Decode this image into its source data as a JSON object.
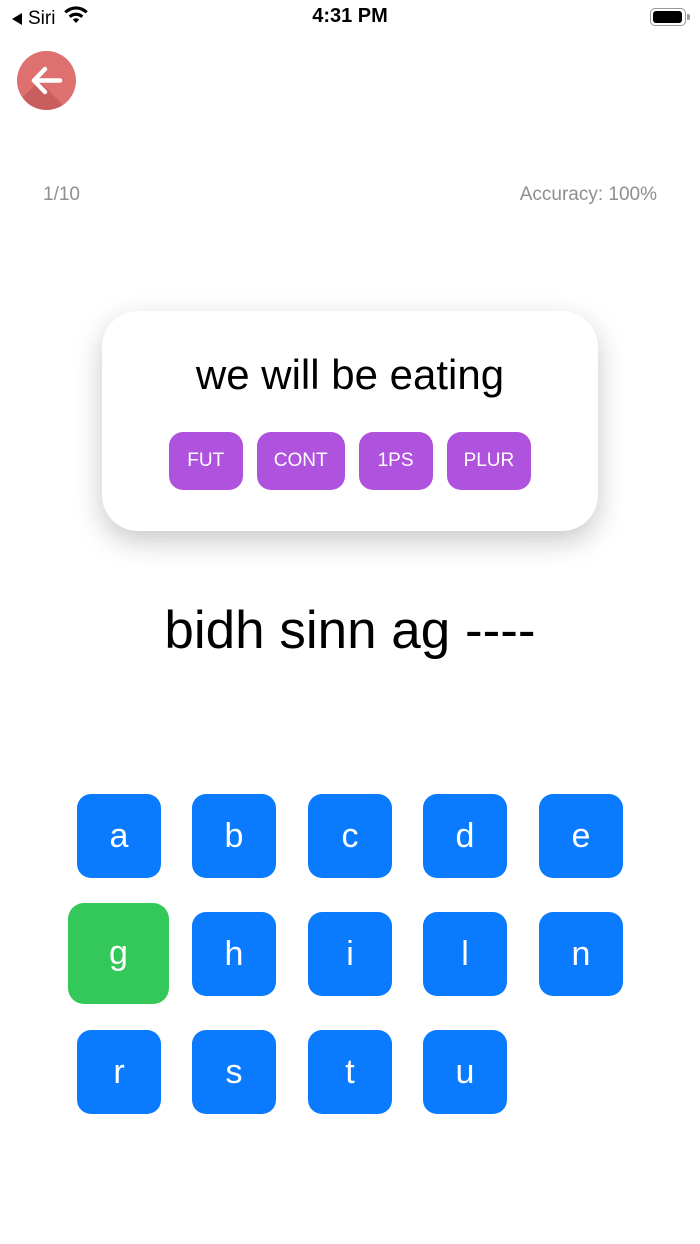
{
  "status_bar": {
    "carrier": "Siri",
    "time": "4:31 PM"
  },
  "header": {
    "back_icon": "arrow-left-icon"
  },
  "progress": {
    "counter": "1/10",
    "accuracy": "Accuracy: 100%"
  },
  "prompt": {
    "text": "we will be eating",
    "tags": [
      "FUT",
      "CONT",
      "1PS",
      "PLUR"
    ]
  },
  "answer": {
    "text": "bidh sinn ag ----"
  },
  "keyboard": {
    "keys": [
      "a",
      "b",
      "c",
      "d",
      "e",
      "g",
      "h",
      "i",
      "l",
      "n",
      "r",
      "s",
      "t",
      "u"
    ],
    "selected": "g"
  },
  "colors": {
    "key": "#0a7bff",
    "key_selected": "#34c759",
    "tag": "#af52de",
    "back_button": "#de7070",
    "muted_text": "#8e8e93"
  }
}
